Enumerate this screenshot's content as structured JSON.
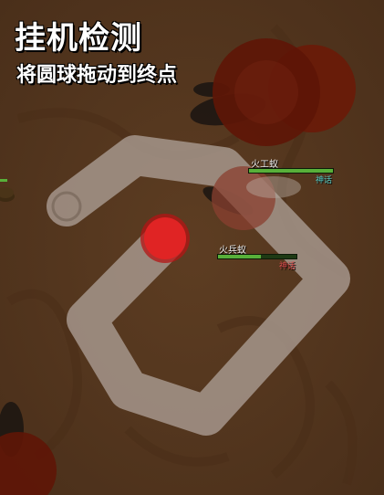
{
  "overlay": {
    "title": "挂机检测",
    "instruction": "将圆球拖动到终点"
  },
  "units": [
    {
      "name": "火工蚁",
      "tag": "神话",
      "tag_color": "#57d0c8",
      "hp_fraction": 1.0
    },
    {
      "name": "火兵蚁",
      "tag": "神话",
      "tag_color": "#e05050",
      "hp_fraction": 0.55
    }
  ],
  "colors": {
    "ground": "#5a3a20",
    "path": "#a89a90",
    "ball": "#e02424",
    "enemy": "#6a1a08",
    "hp_green": "#58b03a"
  }
}
